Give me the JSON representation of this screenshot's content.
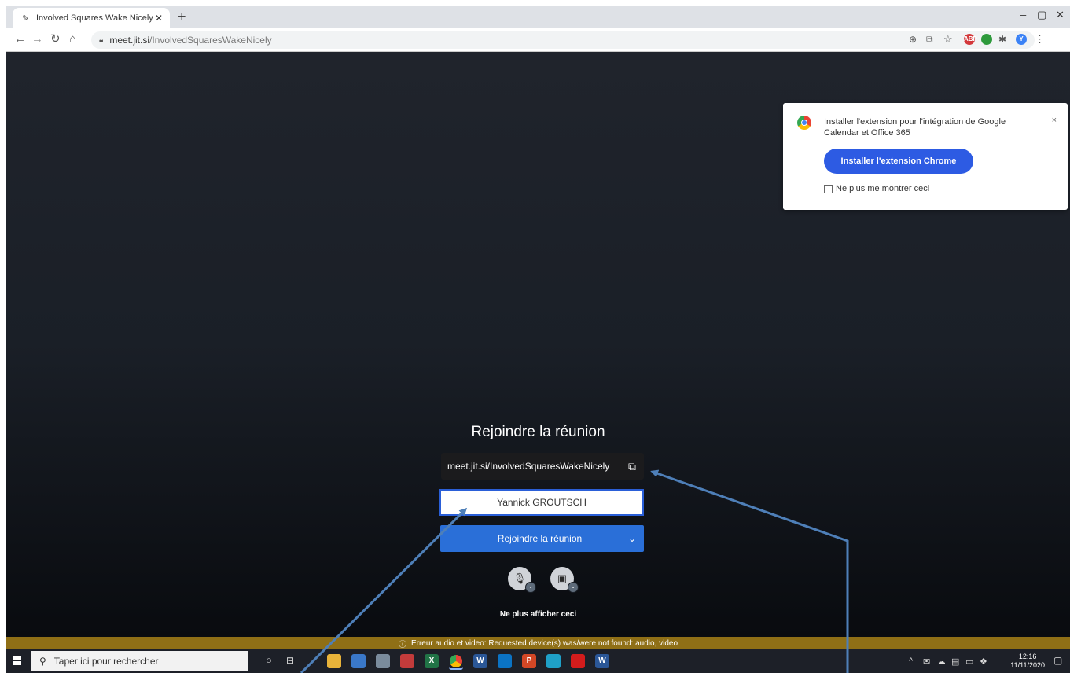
{
  "browser": {
    "tab_title": "Involved Squares Wake Nicely | J",
    "tab_close": "✕",
    "new_tab": "+",
    "url_host": "meet.jit.si",
    "url_path": "/InvolvedSquaresWakeNicely",
    "window_controls": [
      "–",
      "▢",
      "✕"
    ],
    "extensions": [
      {
        "name": "abp-icon",
        "label": "ABP",
        "color": "#d3383b"
      },
      {
        "name": "shield-icon",
        "label": "",
        "color": "#2e9a3c"
      },
      {
        "name": "profile-avatar",
        "label": "Y",
        "color": "#3b82f6"
      }
    ]
  },
  "extension_popup": {
    "message": "Installer l'extension pour l'intégration de Google Calendar et Office 365",
    "install_button": "Installer l'extension Chrome",
    "dont_show_label": "Ne plus me montrer ceci",
    "close": "×"
  },
  "prejoin": {
    "title": "Rejoindre la réunion",
    "meeting_url": "meet.jit.si/InvolvedSquaresWakeNicely",
    "name_value": "Yannick GROUTSCH",
    "join_button": "Rejoindre la réunion",
    "dont_show_again": "Ne plus afficher ceci"
  },
  "error_bar": {
    "text": "Erreur audio et video: Requested device(s) was/were not found: audio, video"
  },
  "taskbar": {
    "search_placeholder": "Taper ici pour rechercher",
    "time": "12:16",
    "date": "11/11/2020",
    "apps": [
      {
        "name": "file-explorer-icon",
        "color": "#e8b33a",
        "glyph": ""
      },
      {
        "name": "thunderbird-icon",
        "color": "#3a78c9",
        "glyph": ""
      },
      {
        "name": "paint-icon",
        "color": "#7a8b9c",
        "glyph": ""
      },
      {
        "name": "app-icon",
        "color": "#c23b3b",
        "glyph": ""
      },
      {
        "name": "excel-icon",
        "color": "#217346",
        "glyph": "X"
      },
      {
        "name": "chrome-icon",
        "color": "#e0a010",
        "glyph": ""
      },
      {
        "name": "word-icon",
        "color": "#2b5797",
        "glyph": "W"
      },
      {
        "name": "outlook-icon",
        "color": "#0b73c4",
        "glyph": ""
      },
      {
        "name": "powerpoint-icon",
        "color": "#d24726",
        "glyph": "P"
      },
      {
        "name": "edge-icon",
        "color": "#1fa0c8",
        "glyph": ""
      },
      {
        "name": "acrobat-icon",
        "color": "#d31c1c",
        "glyph": ""
      },
      {
        "name": "word-icon-2",
        "color": "#2b5797",
        "glyph": "W"
      }
    ]
  }
}
